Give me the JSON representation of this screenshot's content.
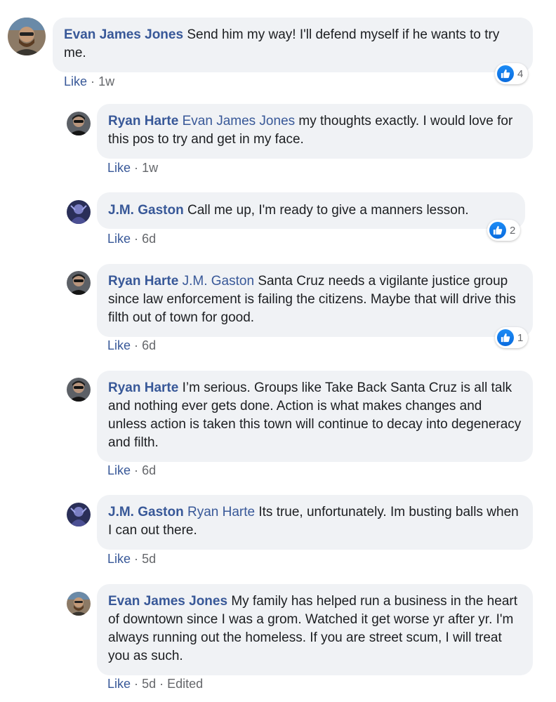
{
  "comments": [
    {
      "author": "Evan James Jones",
      "mention": "",
      "text": "Send him my way! I'll defend myself if he wants to try me.",
      "like_label": "Like",
      "time": "1w",
      "edited": "",
      "reaction_count": "4"
    },
    {
      "author": "Ryan Harte",
      "mention": "Evan James Jones",
      "text": "my thoughts exactly. I would love for this pos to try and get in my face.",
      "like_label": "Like",
      "time": "1w",
      "edited": "",
      "reaction_count": ""
    },
    {
      "author": "J.M. Gaston",
      "mention": "",
      "text": "Call me up, I'm ready to give a manners lesson.",
      "like_label": "Like",
      "time": "6d",
      "edited": "",
      "reaction_count": "2"
    },
    {
      "author": "Ryan Harte",
      "mention": "J.M. Gaston",
      "text": "Santa Cruz needs a vigilante justice group since law enforcement is failing the citizens. Maybe that will drive this filth out of town for good.",
      "like_label": "Like",
      "time": "6d",
      "edited": "",
      "reaction_count": "1"
    },
    {
      "author": "Ryan Harte",
      "mention": "",
      "text": "I’m serious. Groups like Take Back Santa Cruz is all talk and nothing ever gets done. Action is what makes changes and unless action is taken this town will continue to decay into degeneracy and filth.",
      "like_label": "Like",
      "time": "6d",
      "edited": "",
      "reaction_count": ""
    },
    {
      "author": "J.M. Gaston",
      "mention": "Ryan Harte",
      "text": "Its true, unfortunately. Im busting balls when I can out there.",
      "like_label": "Like",
      "time": "5d",
      "edited": "",
      "reaction_count": ""
    },
    {
      "author": "Evan James Jones",
      "mention": "",
      "text": "My family has helped run a business in the heart of downtown since I was a grom. Watched it get worse yr after yr. I'm always running out the homeless. If you are street scum, I will treat you as such.",
      "like_label": "Like",
      "time": "5d",
      "edited": "Edited",
      "reaction_count": ""
    }
  ],
  "separator": "·",
  "colors": {
    "author": "#385898",
    "meta": "#65676b",
    "bubble": "#f0f2f5",
    "like_blue": "#1877f2"
  },
  "icons": {
    "reaction": "thumbs-up-icon",
    "avatar_evan": "avatar-evan-james-jones",
    "avatar_ryan": "avatar-ryan-harte",
    "avatar_gaston": "avatar-jm-gaston"
  }
}
